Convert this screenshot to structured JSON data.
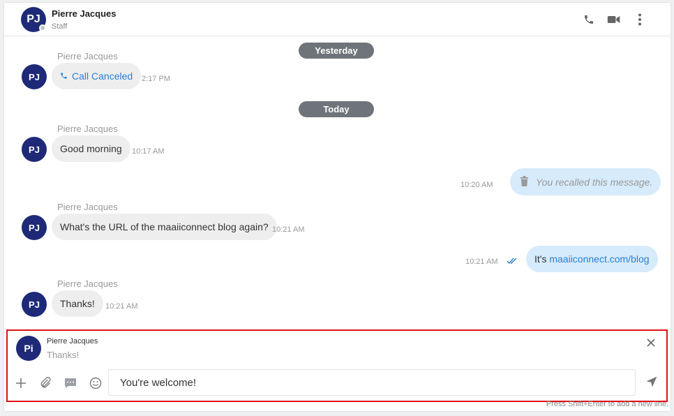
{
  "header": {
    "avatar_initials": "PJ",
    "name": "Pierre Jacques",
    "role": "Staff"
  },
  "dividers": {
    "yesterday": "Yesterday",
    "today": "Today"
  },
  "messages": [
    {
      "sender": "Pierre Jacques",
      "text": "Call Canceled",
      "time": "2:17 PM"
    },
    {
      "sender": "Pierre Jacques",
      "text": "Good morning",
      "time": "10:17 AM"
    },
    {
      "text": "You recalled this message.",
      "time": "10:20 AM"
    },
    {
      "sender": "Pierre Jacques",
      "text": "What's the URL of the maaiiconnect blog again?",
      "time": "10:21 AM"
    },
    {
      "text_prefix": "It's ",
      "link": "maaiiconnect.com/blog",
      "time": "10:21 AM"
    },
    {
      "sender": "Pierre Jacques",
      "text": "Thanks!",
      "time": "10:21 AM"
    }
  ],
  "avatars": {
    "incoming": "PJ"
  },
  "composer": {
    "reply_avatar": "Pi",
    "reply_name": "Pierre Jacques",
    "reply_text": "Thanks!",
    "input_value": "You're welcome!",
    "hint": "Press Shift+Enter to add a new line."
  },
  "colors": {
    "avatar": "#1e2a78",
    "pill": "#6e7479",
    "outgoing_bubble": "#d6ebfb",
    "incoming_bubble": "#eeeeee",
    "link": "#2a7fd4",
    "highlight_border": "#e01010"
  },
  "icons": [
    "phone-icon",
    "video-icon",
    "more-vertical-icon",
    "call-icon",
    "trash-icon",
    "double-check-icon",
    "close-icon",
    "plus-icon",
    "paperclip-icon",
    "sms-icon",
    "emoji-icon",
    "send-icon"
  ]
}
